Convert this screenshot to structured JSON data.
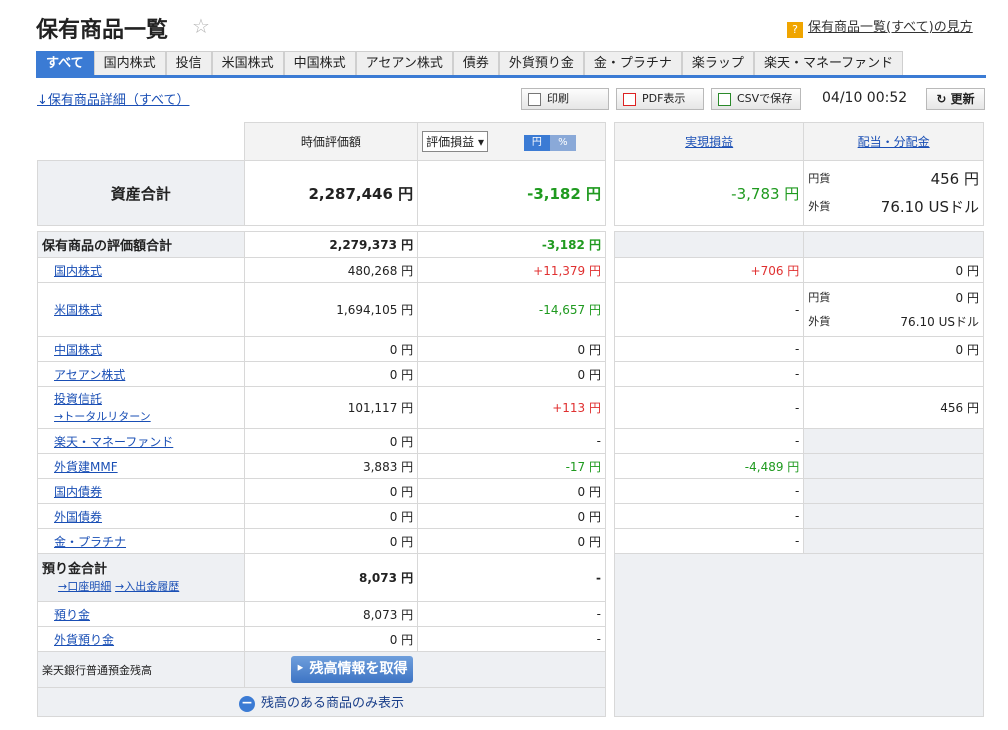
{
  "header": {
    "title": "保有商品一覧",
    "help_text": "保有商品一覧(すべて)の見方"
  },
  "tabs": [
    "すべて",
    "国内株式",
    "投信",
    "米国株式",
    "中国株式",
    "アセアン株式",
    "債券",
    "外貨預り金",
    "金・プラチナ",
    "楽ラップ",
    "楽天・マネーファンド"
  ],
  "detail_link": "↓保有商品詳細（すべて）",
  "toolbar": {
    "print": "印刷",
    "pdf": "PDF表示",
    "csv": "CSVで保存",
    "timestamp": "04/10 00:52",
    "refresh": "更新"
  },
  "cols": {
    "market_value": "時価評価額",
    "eval_select": "評価損益",
    "toggle_yen": "円",
    "toggle_pct": "%",
    "realized": "実現損益",
    "dividend": "配当・分配金"
  },
  "total": {
    "label": "資産合計",
    "value": "2,287,446 円",
    "eval": "-3,182 円",
    "realized": "-3,783 円",
    "div_yen_label": "円貨",
    "div_yen": "456 円",
    "div_fx_label": "外貨",
    "div_fx": "76.10 USドル"
  },
  "holdings_total": {
    "label": "保有商品の評価額合計",
    "value": "2,279,373 円",
    "eval": "-3,182 円"
  },
  "rows": [
    {
      "name": "国内株式",
      "value": "480,268 円",
      "eval": "+11,379 円",
      "realized": "+706 円",
      "dividend": "0 円"
    },
    {
      "name": "米国株式",
      "value": "1,694,105 円",
      "eval": "-14,657 円",
      "realized": "-",
      "div_yen_label": "円貨",
      "div_yen": "0 円",
      "div_fx_label": "外貨",
      "div_fx": "76.10 USドル"
    },
    {
      "name": "中国株式",
      "value": "0 円",
      "eval": "0 円",
      "realized": "-",
      "dividend": "0 円"
    },
    {
      "name": "アセアン株式",
      "value": "0 円",
      "eval": "0 円",
      "realized": "-",
      "dividend": ""
    },
    {
      "name": "投資信託",
      "sub": "→トータルリターン",
      "value": "101,117 円",
      "eval": "+113 円",
      "realized": "-",
      "dividend": "456 円"
    },
    {
      "name": "楽天・マネーファンド",
      "value": "0 円",
      "eval": "-",
      "realized": "-"
    },
    {
      "name": "外貨建MMF",
      "value": "3,883 円",
      "eval": "-17 円",
      "realized": "-4,489 円"
    },
    {
      "name": "国内債券",
      "value": "0 円",
      "eval": "0 円",
      "realized": "-"
    },
    {
      "name": "外国債券",
      "value": "0 円",
      "eval": "0 円",
      "realized": "-"
    },
    {
      "name": "金・プラチナ",
      "value": "0 円",
      "eval": "0 円",
      "realized": "-"
    }
  ],
  "deposit": {
    "label": "預り金合計",
    "link1": "→口座明細",
    "link2": "→入出金履歴",
    "value": "8,073 円",
    "eval": "-",
    "rows": [
      {
        "name": "預り金",
        "value": "8,073 円",
        "eval": "-"
      },
      {
        "name": "外貨預り金",
        "value": "0 円",
        "eval": "-"
      }
    ]
  },
  "bank": {
    "label": "楽天銀行普通預金残高",
    "button": "残高情報を取得"
  },
  "show_only": "残高のある商品のみ表示"
}
